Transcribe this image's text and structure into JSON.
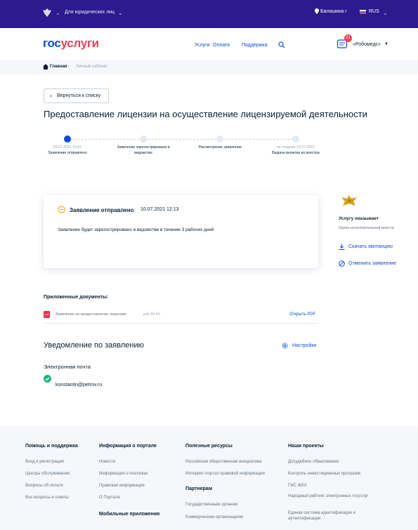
{
  "colors": {
    "topbar": "#2c1a8e",
    "accent": "#0d4cd3",
    "brand_red": "#ee3f58",
    "success": "#1fb37a",
    "warning": "#f5a623"
  },
  "topbar": {
    "legal_entities": "Для юридических лиц",
    "city": "Балашиха г",
    "language": "RUS"
  },
  "header": {
    "logo_part1": "гос",
    "logo_part2": "услуги",
    "nav": [
      "Услуги",
      "Оплата",
      "Поддержка"
    ],
    "search_icon": "search-icon",
    "notification_count": "21",
    "user_name": "«Робомедс»"
  },
  "breadcrumb": {
    "home": "Главная",
    "current": "Личный кабинет"
  },
  "main": {
    "back_label": "Вернуться к списку",
    "title": "Предоставление лицензии на осуществление лицензируемой деятельности",
    "steps": [
      {
        "date": "03.07.2021 15:41",
        "label": "Заявление отправлено",
        "state": "done"
      },
      {
        "date": "",
        "label": "Заявление зарегистрировано в ведомстве",
        "state": "pending"
      },
      {
        "date": "",
        "label": "Рассмотрение заявления",
        "state": "pending"
      },
      {
        "date": "не позднее 14.07.2021",
        "label": "Выдача выписки из реестра",
        "state": "pending"
      }
    ],
    "status": {
      "title": "Заявление отправлено",
      "date": "10.07.2021 12:13",
      "message": "Заявление будет зарегистрировано в ведомстве в течение 3 рабочих дней"
    }
  },
  "sidebar": {
    "title": "Услугу оказывает",
    "org": "Орган исполнительной власти",
    "download_label": "Скачать квитанцию",
    "cancel_label": "Отменить заявление"
  },
  "documents": {
    "title": "Приложенные документы:",
    "items": [
      {
        "name": "Заявление на предоставление лицензии",
        "meta": "pdf, 86 Кб",
        "open_label": "Открыть PDF"
      }
    ]
  },
  "notifications": {
    "title": "Уведомление по заявлению",
    "settings_label": "Настройки",
    "email_label": "Электронная почта",
    "email": "konstantin@petrov.ru"
  },
  "footer": {
    "columns": [
      {
        "title": "Помощь и поддержка",
        "links": [
          "Вход и регистрация",
          "Центры обслуживания",
          "Вопросы об оплате",
          "Все вопросы и ответы"
        ]
      },
      {
        "title": "Информация о портале",
        "links": [
          "Новости",
          "Информация о платежах",
          "Правовая информация",
          "О Портале"
        ],
        "subtitle": "Мобильные приложения"
      },
      {
        "title": "Полезные ресурсы",
        "links": [
          "Российская общественная инициатива",
          "Интернет-портал правовой информации"
        ],
        "subtitle": "Партнерам",
        "sublinks": [
          "Государственным органам",
          "Коммерческим организациям"
        ]
      },
      {
        "title": "Наши проекты",
        "links": [
          "Досудебное обжалование",
          "Контроль инвестиционных программ",
          "ГИС ЖКХ",
          "Народный рейтинг электронных госуслуг",
          "Единая система идентификации и аутентификации"
        ]
      }
    ]
  }
}
